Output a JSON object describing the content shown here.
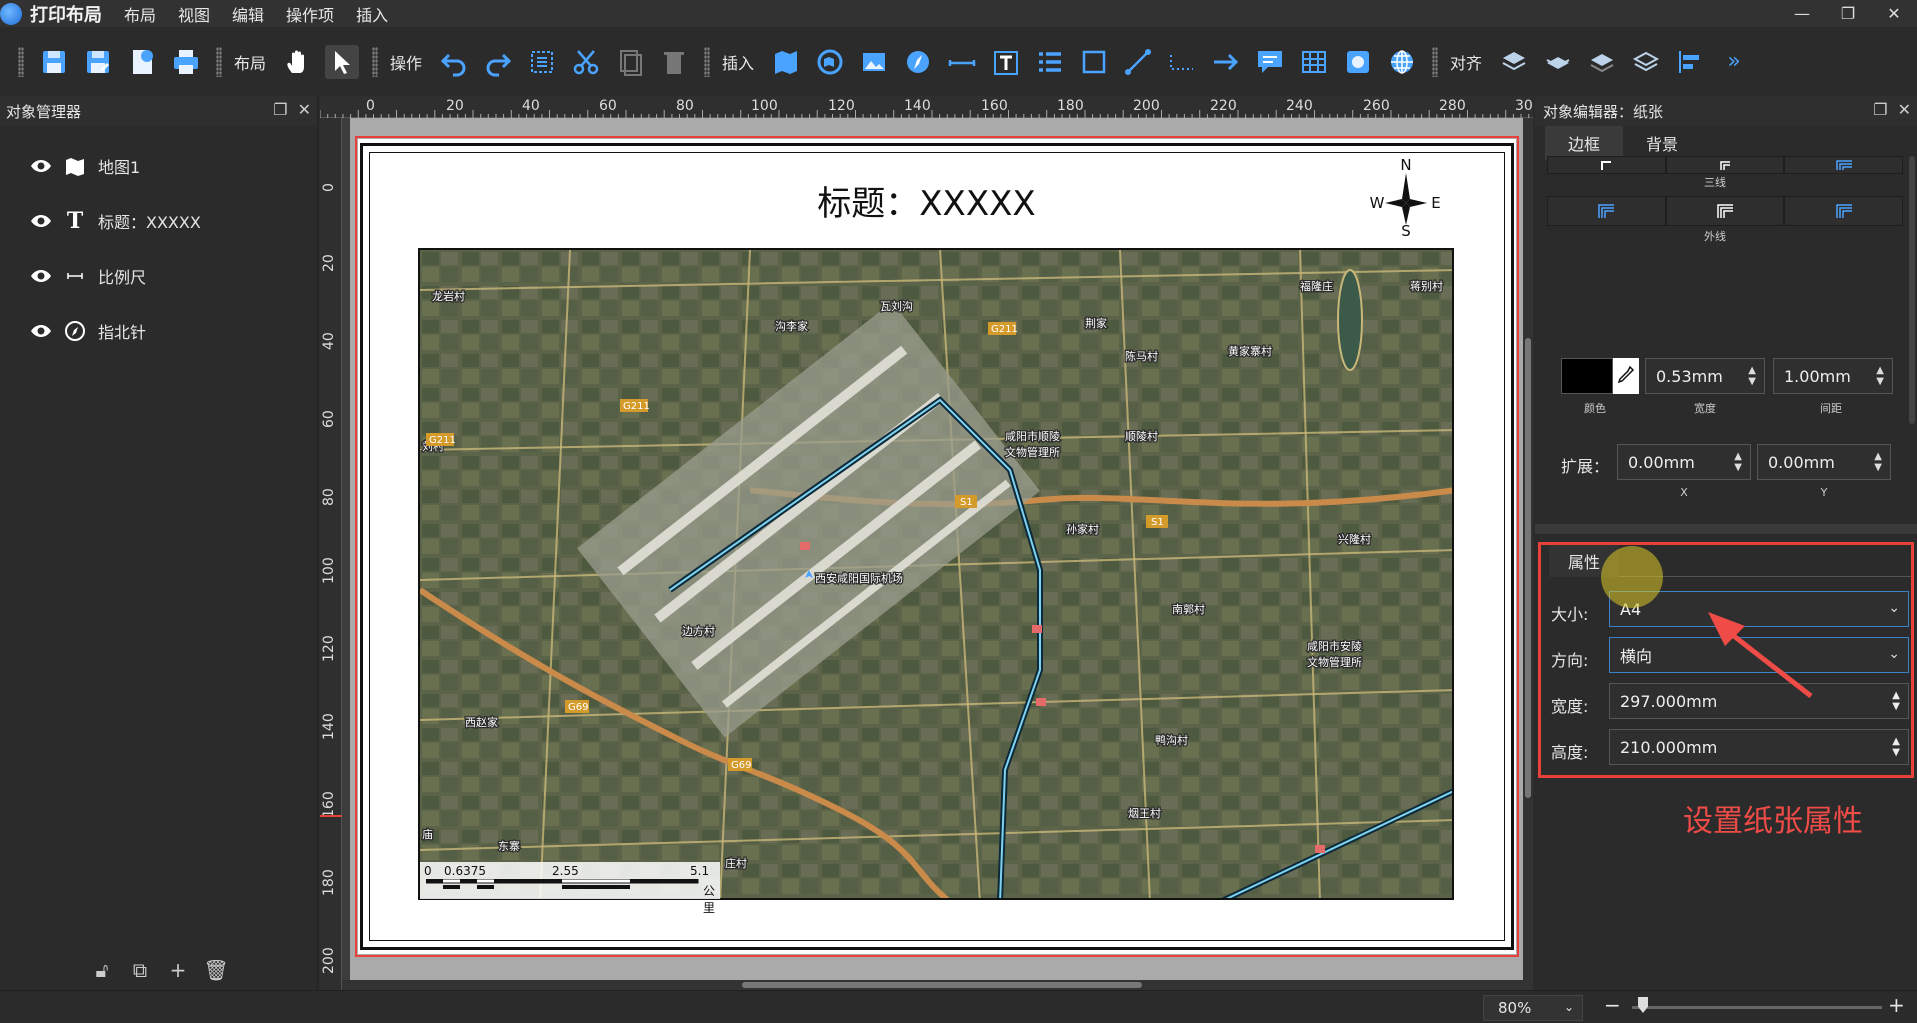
{
  "app": {
    "title": "打印布局"
  },
  "menu": [
    "布局",
    "视图",
    "编辑",
    "操作项",
    "插入"
  ],
  "toolbar": {
    "layout_label": "布局",
    "operate_label": "操作",
    "insert_label": "插入",
    "align_label": "对齐"
  },
  "left_panel": {
    "title": "对象管理器",
    "items": [
      {
        "label": "地图1",
        "icon": "map-icon"
      },
      {
        "label": "标题：XXXXX",
        "icon": "text-icon"
      },
      {
        "label": "比例尺",
        "icon": "scalebar-icon"
      },
      {
        "label": "指北针",
        "icon": "compass-icon"
      }
    ]
  },
  "ruler": {
    "top": [
      "0",
      "20",
      "40",
      "60",
      "80",
      "100",
      "120",
      "140",
      "160",
      "180",
      "200",
      "220",
      "240",
      "260",
      "280",
      "30"
    ],
    "left": [
      "0",
      "20",
      "40",
      "60",
      "80",
      "100",
      "120",
      "140",
      "160",
      "180",
      "200"
    ]
  },
  "layout": {
    "title": "标题：XXXXX",
    "compass": {
      "n": "N",
      "s": "S",
      "e": "E",
      "w": "W"
    },
    "scalebar": {
      "t0": "0",
      "t1": "0.6375",
      "t2": "2.55",
      "t3": "5.1",
      "unit": "公里"
    },
    "map_labels": {
      "l1": "龙岩村",
      "l2": "沟李家",
      "l3": "瓦刘沟",
      "l4": "荆家",
      "l5": "陈马村",
      "l6": "黄家寨村",
      "l7": "福隆庄",
      "l8": "蒋别村",
      "l9": "咸阳市顺陵",
      "l10": "文物管理所",
      "l11": "顺陵村",
      "l12": "孙家村",
      "l13": "兴隆村",
      "l14": "西安咸阳国际机场",
      "l15": "边方村",
      "l16": "南郭村",
      "l17": "咸阳市安陵",
      "l18": "文物管理所",
      "l19": "西赵家",
      "l20": "鸭沟村",
      "l21": "烟王村",
      "l22": "东寨",
      "l23": "刘村",
      "l24": "庙",
      "l25": "庄村"
    },
    "road_labels": {
      "r1": "G211",
      "r2": "G211",
      "r3": "G211",
      "r4": "S1",
      "r5": "S1",
      "r6": "G69",
      "r7": "G69"
    }
  },
  "right_panel": {
    "title": "对象编辑器：纸张",
    "tabs": [
      "边框",
      "背景"
    ],
    "triple_line_caption": "三线",
    "outer_line_caption": "外线",
    "color_caption": "颜色",
    "width_value": "0.53mm",
    "width_caption": "宽度",
    "spacing_value": "1.00mm",
    "spacing_caption": "间距",
    "expand_label": "扩展：",
    "expand_x_value": "0.00mm",
    "expand_x_caption": "X",
    "expand_y_value": "0.00mm",
    "expand_y_caption": "Y",
    "props_tab": "属性",
    "size_label": "大小:",
    "size_value": "A4",
    "orient_label": "方向:",
    "orient_value": "横向",
    "width_label": "宽度:",
    "page_width_value": "297.000mm",
    "height_label": "高度:",
    "page_height_value": "210.000mm",
    "annotation": "设置纸张属性"
  },
  "status": {
    "zoom": "80%"
  },
  "colors": {
    "accent_red": "#e8403a",
    "accent_blue": "#4aa3ff"
  }
}
